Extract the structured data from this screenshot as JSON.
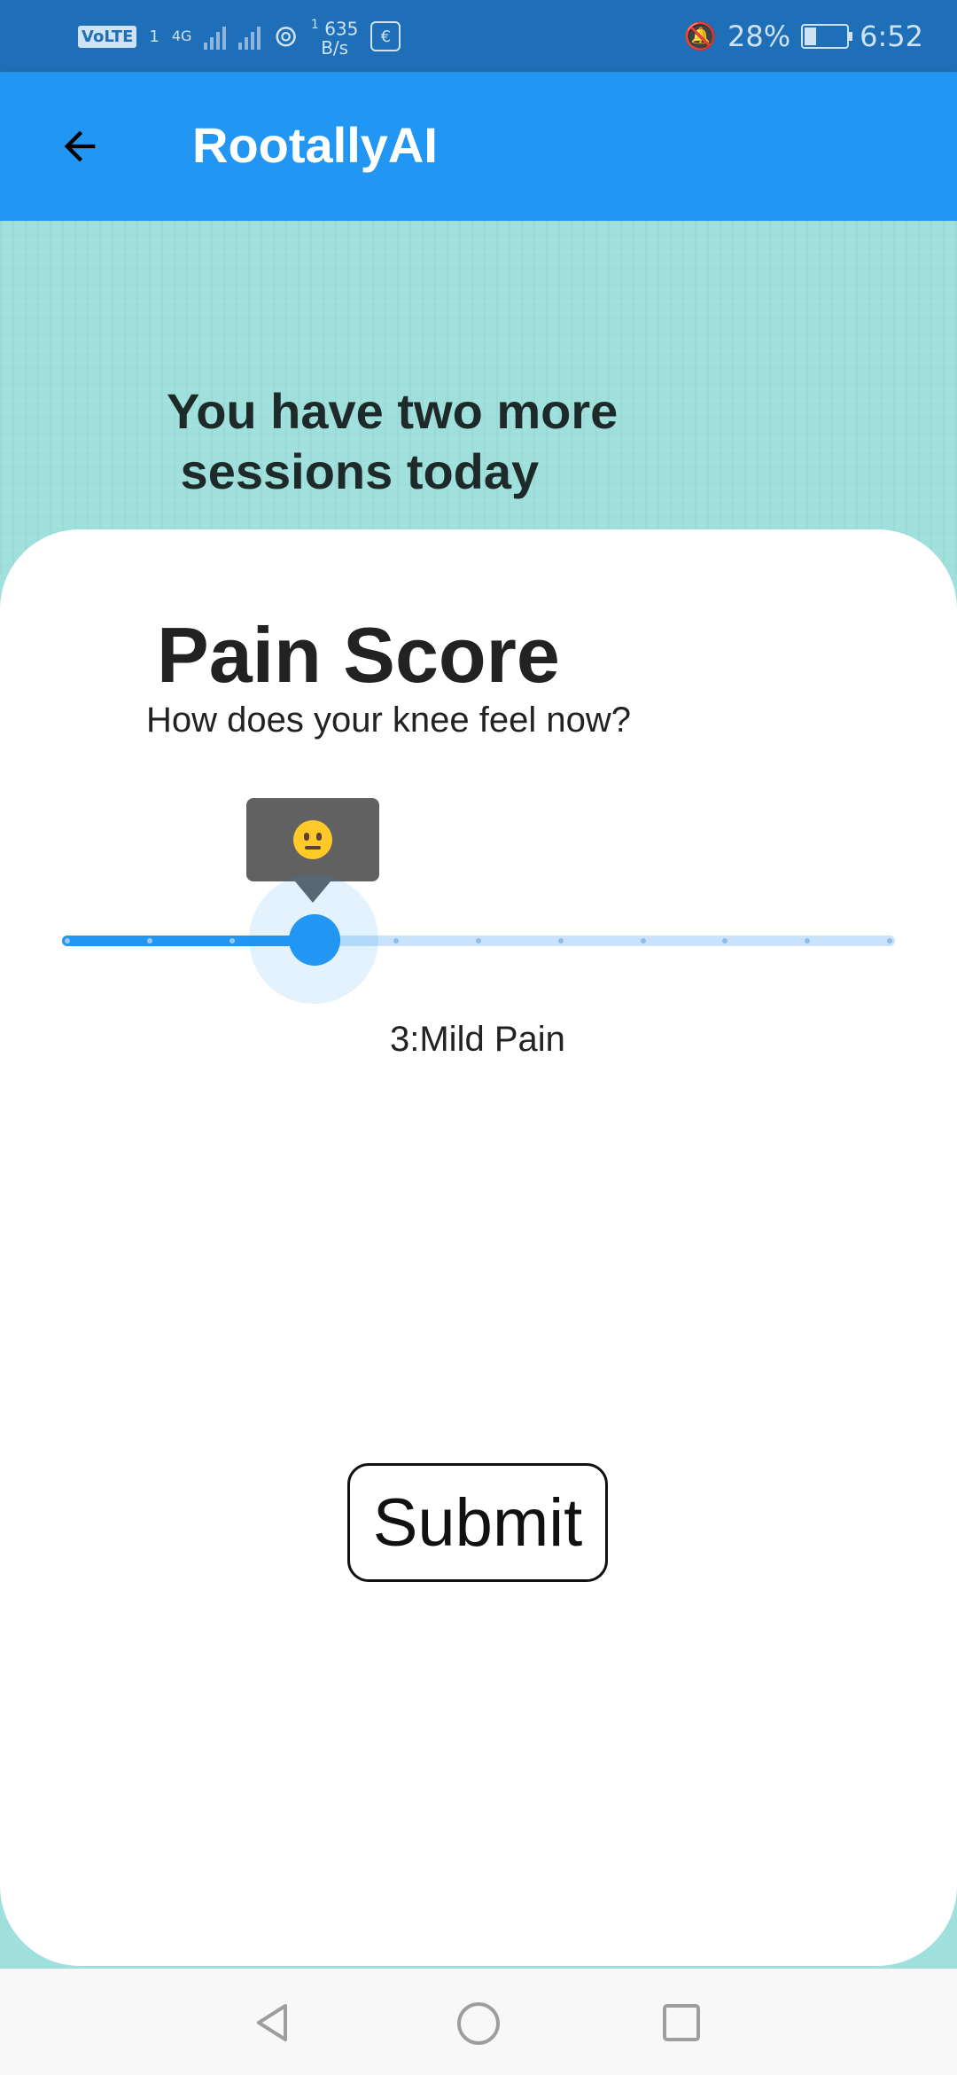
{
  "status_bar": {
    "volte": "VoLTE",
    "sim": "1",
    "network": "4G",
    "speed_value": "635",
    "speed_unit": "B/s",
    "speed_superscript": "1",
    "battery_percent": "28%",
    "battery_level": 0.28,
    "time": "6:52"
  },
  "app_bar": {
    "title": "RootallyAI",
    "back_icon": "arrow-left-icon"
  },
  "hero": {
    "message_line1": "You have two more",
    "message_line2": " sessions today"
  },
  "card": {
    "title": "Pain Score",
    "subtitle": "How does your knee feel now?"
  },
  "slider": {
    "min": 0,
    "max": 10,
    "value": 3,
    "tooltip_icon": "neutral-face-emoji",
    "value_label": "3:Mild Pain",
    "active_color": "#2196f3",
    "inactive_color": "#c8e3fb"
  },
  "submit": {
    "label": "Submit"
  },
  "nav_bar": {
    "back_icon": "triangle-back-icon",
    "home_icon": "circle-home-icon",
    "recents_icon": "square-recents-icon"
  }
}
